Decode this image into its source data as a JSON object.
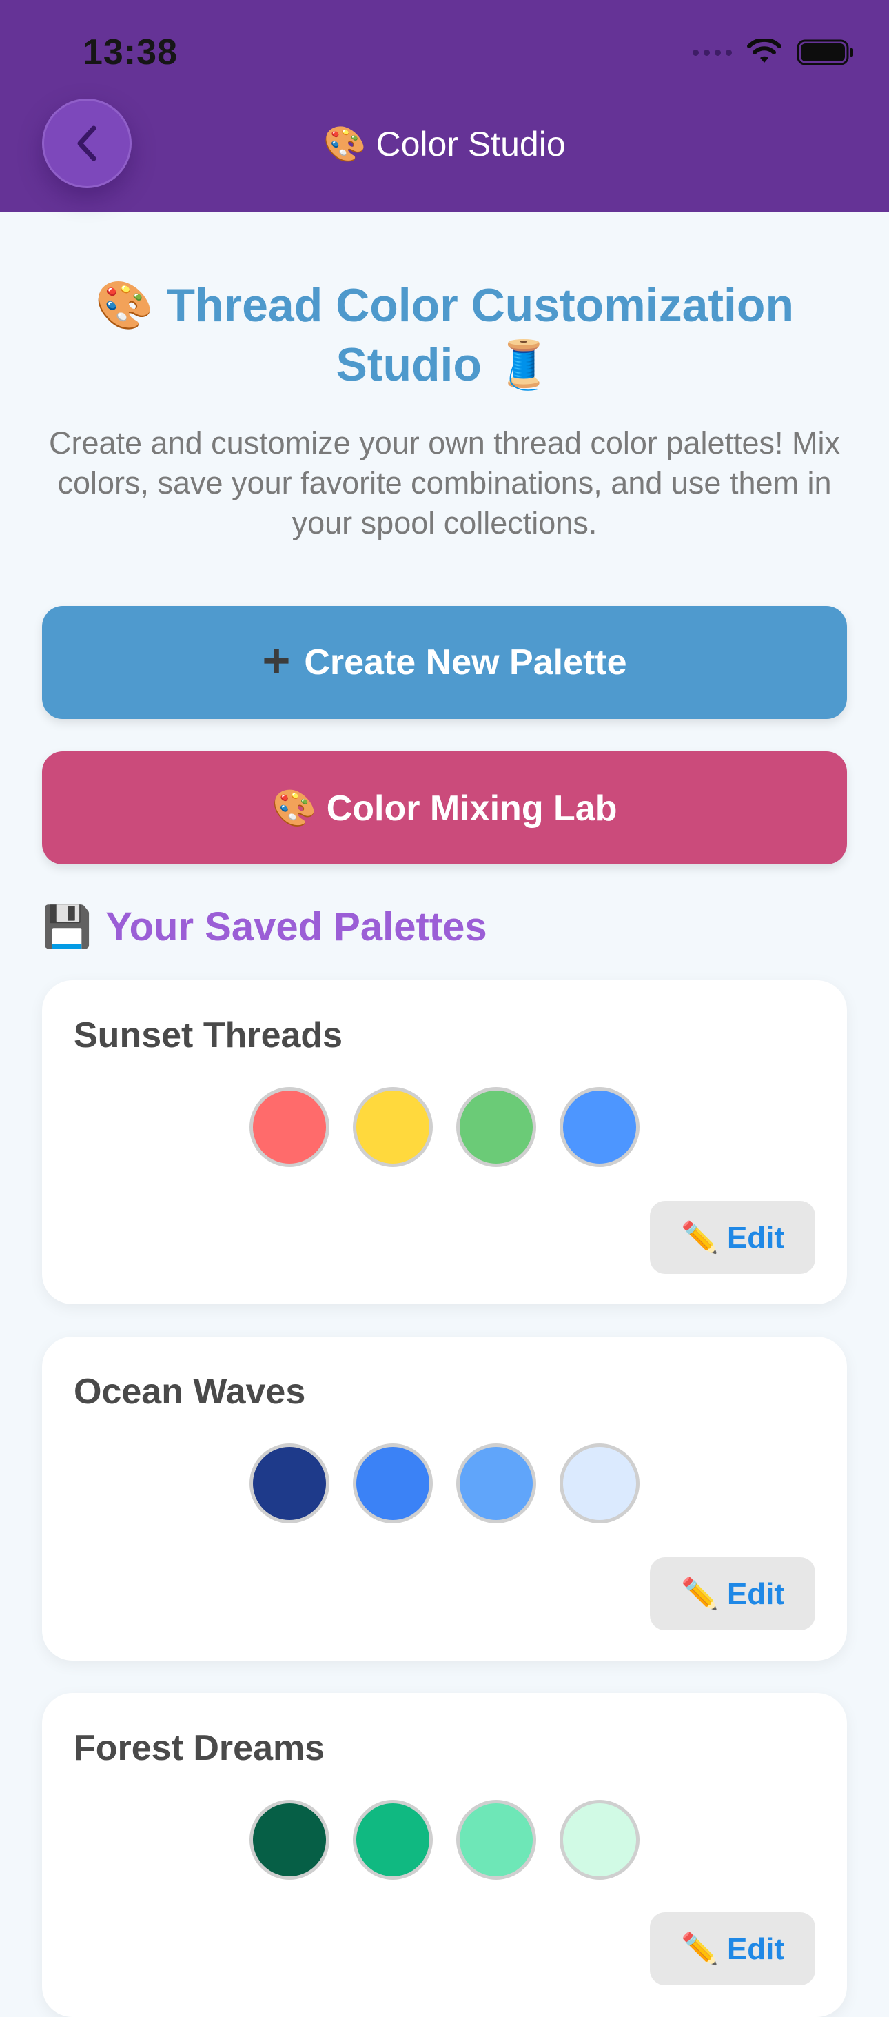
{
  "status_bar": {
    "time": "13:38"
  },
  "header": {
    "title": "🎨 Color Studio",
    "back_icon": "chevron-left-icon"
  },
  "hero": {
    "title_line1": "🎨 Thread Color Customization",
    "title_line2": "Studio 🧵",
    "description": "Create and customize your own thread color palettes! Mix colors, save your favorite combinations, and use them in your spool collections."
  },
  "actions": {
    "create_label": "Create New Palette",
    "create_icon": "plus-icon",
    "mix_label": "🎨 Color Mixing Lab"
  },
  "saved_section": {
    "icon": "💾",
    "title": "Your Saved Palettes"
  },
  "palettes": [
    {
      "name": "Sunset Threads",
      "colors": [
        "#ff6b6b",
        "#ffd93d",
        "#6bcb77",
        "#4d96ff"
      ],
      "edit_label": "✏️ Edit"
    },
    {
      "name": "Ocean Waves",
      "colors": [
        "#1e3a8a",
        "#3b82f6",
        "#60a5fa",
        "#dbeafe"
      ],
      "edit_label": "✏️ Edit"
    },
    {
      "name": "Forest Dreams",
      "colors": [
        "#065f46",
        "#10b981",
        "#6ee7b7",
        "#d1fae5"
      ],
      "edit_label": "✏️ Edit"
    }
  ],
  "theme": {
    "header_purple": "#653396",
    "back_button_purple": "#7d48bb",
    "title_blue": "#4e99cc",
    "create_button_blue": "#4f9ace",
    "mix_button_pink": "#cb4b7b",
    "section_purple": "#9b5ed6",
    "edit_blue": "#1f88e6",
    "page_background": "#f3f8fc"
  }
}
